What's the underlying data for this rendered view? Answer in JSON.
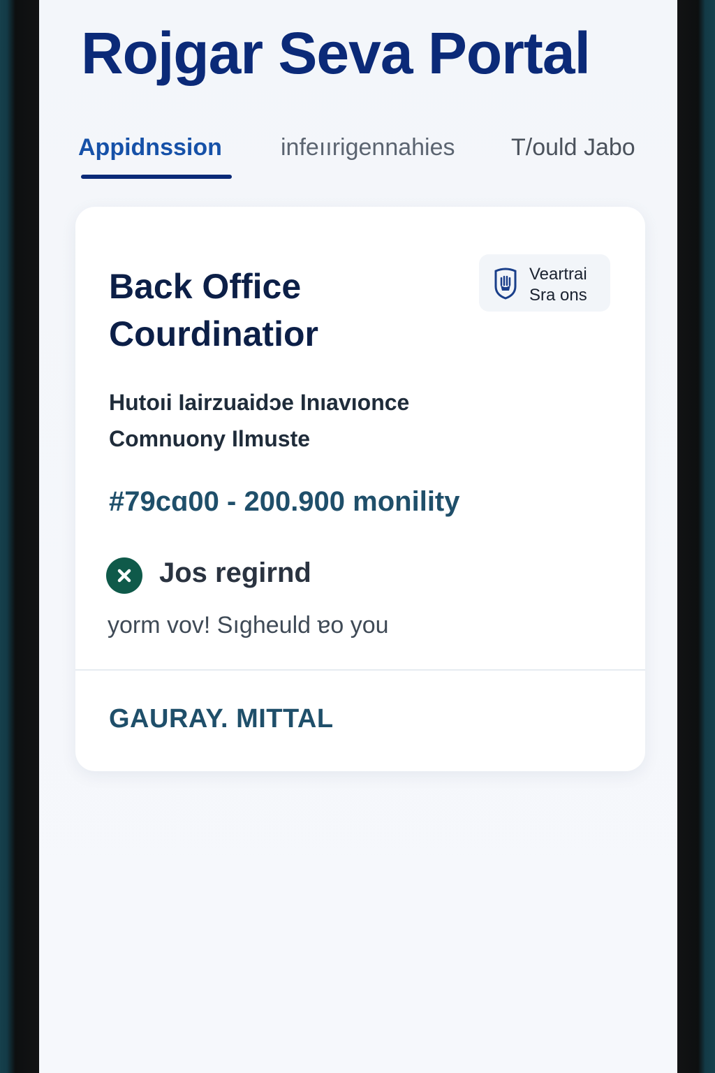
{
  "portal": {
    "title": "Rojgar Seva Portal"
  },
  "tabs": [
    {
      "label": "Appidnssion",
      "active": true
    },
    {
      "label": "infeıırigennahies",
      "active": false
    },
    {
      "label": "T/ould Jabo",
      "active": false
    }
  ],
  "job_card": {
    "title_line1": "Back Office",
    "title_line2": "Courdinatior",
    "company_badge": {
      "line1": "Veartrai",
      "line2": "Sra ons",
      "icon": "shield-logo-icon"
    },
    "company_line1": "Hutoıi Iairzuaidɔe Inıavıonce",
    "company_line2": "Comnuony Ilmuste",
    "salary": "#79cɑ00 - 200.900 monility",
    "status": {
      "text": "Jos regirnd",
      "icon": "close-circle-icon",
      "icon_color": "#0f5a4a"
    },
    "message": "yorm vov! Sıgheuld ɐo you",
    "recruiter": "GAURAY. MITTAL"
  },
  "colors": {
    "title": "#0b2a78",
    "active_tab": "#1651a8",
    "salary": "#1f4f6a"
  }
}
